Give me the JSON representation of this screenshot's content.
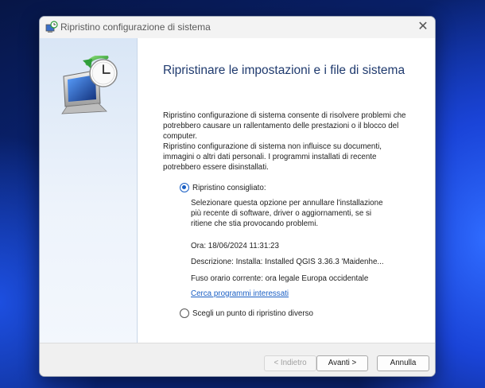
{
  "window": {
    "title": "Ripristino configurazione di sistema",
    "close_glyph": "✕"
  },
  "main": {
    "heading": "Ripristinare le impostazioni e i file di sistema",
    "paragraph1": [
      "Ripristino configurazione di sistema consente di risolvere problemi che",
      "potrebbero causare un rallentamento delle prestazioni o il blocco del",
      "computer."
    ],
    "paragraph2": [
      "Ripristino configurazione di sistema non influisce su documenti,",
      "immagini o altri dati personali. I programmi installati di recente",
      "potrebbero essere disinstallati."
    ],
    "option_recommended": {
      "label": "Ripristino consigliato:",
      "checked": true,
      "description": [
        "Selezionare questa opzione per annullare l'installazione",
        "più recente di software, driver o aggiornamenti, se si",
        "ritiene che stia provocando problemi."
      ]
    },
    "restore_point": {
      "time": "Ora: 18/06/2024 11:31:23",
      "description": "Descrizione: Installa: Installed QGIS 3.36.3 'Maidenhe...",
      "timezone": "Fuso orario corrente: ora legale Europa occidentale"
    },
    "link_label": "Cerca programmi interessati",
    "option_other": {
      "label": "Scegli un punto di ripristino diverso",
      "checked": false
    }
  },
  "footer": {
    "back_label": "< Indietro",
    "next_label": "Avanti >",
    "cancel_label": "Annulla"
  },
  "icons": {
    "title": "system-restore-icon",
    "sidebar": "system-restore-monitor-clock-icon"
  },
  "colors": {
    "accent": "#1a5fc4",
    "heading": "#1f3a6e"
  }
}
